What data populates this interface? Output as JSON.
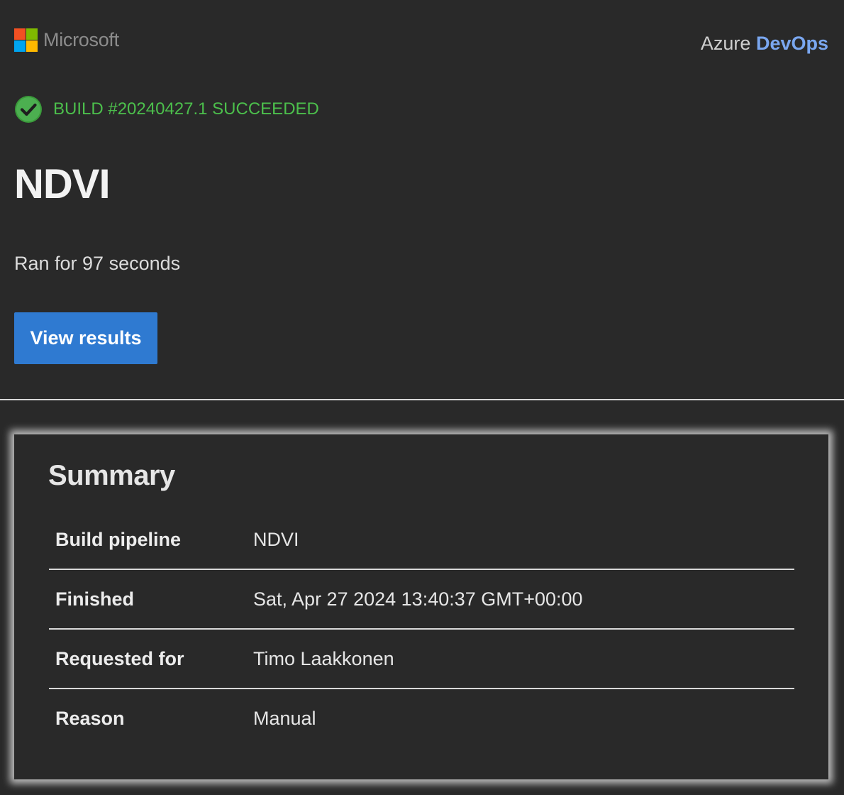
{
  "header": {
    "logo_text": "Microsoft",
    "logo_colors": [
      "#f25022",
      "#7fba00",
      "#00a4ef",
      "#ffb900"
    ],
    "brand_prefix": "Azure",
    "brand_highlight": "DevOps"
  },
  "status": {
    "icon": "check-circle-icon",
    "text": "BUILD #20240427.1 SUCCEEDED",
    "color": "#4cbf4c"
  },
  "pipeline_title": "NDVI",
  "duration_text": "Ran for 97 seconds",
  "view_results_label": "View results",
  "accent_color": "#2f7ad1",
  "summary": {
    "title": "Summary",
    "rows": [
      {
        "label": "Build pipeline",
        "value": "NDVI"
      },
      {
        "label": "Finished",
        "value": "Sat, Apr 27 2024 13:40:37 GMT+00:00"
      },
      {
        "label": "Requested for",
        "value": "Timo Laakkonen"
      },
      {
        "label": "Reason",
        "value": "Manual"
      }
    ]
  }
}
